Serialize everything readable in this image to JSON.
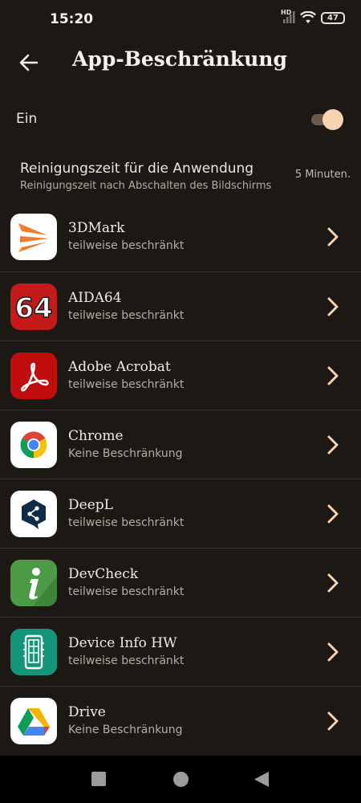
{
  "status_bar": {
    "time": "15:20",
    "network_badge": "HD",
    "battery": "47"
  },
  "header": {
    "title": "App-Beschränkung"
  },
  "toggle_row": {
    "label": "Ein",
    "enabled": true
  },
  "cleanup": {
    "title": "Reinigungszeit für die Anwendung",
    "subtitle": "Reinigungszeit nach Abschalten des Bildschirms",
    "value": "5 Minuten."
  },
  "apps": [
    {
      "name": "3DMark",
      "status": "teilweise beschränkt",
      "icon": "3dmark-icon"
    },
    {
      "name": "AIDA64",
      "status": "teilweise beschränkt",
      "icon": "aida64-icon"
    },
    {
      "name": "Adobe Acrobat",
      "status": "teilweise beschränkt",
      "icon": "adobe-acrobat-icon"
    },
    {
      "name": "Chrome",
      "status": "Keine Beschränkung",
      "icon": "chrome-icon"
    },
    {
      "name": "DeepL",
      "status": "teilweise beschränkt",
      "icon": "deepl-icon"
    },
    {
      "name": "DevCheck",
      "status": "teilweise beschränkt",
      "icon": "devcheck-icon"
    },
    {
      "name": "Device Info HW",
      "status": "teilweise beschränkt",
      "icon": "device-info-hw-icon"
    },
    {
      "name": "Drive",
      "status": "Keine Beschränkung",
      "icon": "drive-icon"
    }
  ],
  "aida64_icon_text": "64",
  "colors": {
    "background": "#1c1915",
    "accent": "#f7d3b0",
    "toggle_track": "#6b5a4b"
  }
}
